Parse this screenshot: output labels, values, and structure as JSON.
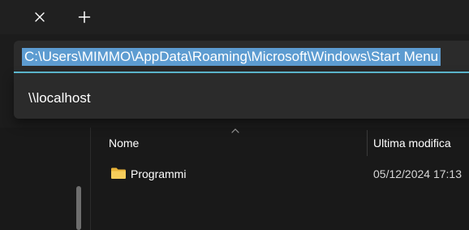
{
  "tabstrip": {
    "close_icon": "close-icon",
    "new_tab_icon": "plus-icon"
  },
  "address_bar": {
    "value": "C:\\Users\\MIMMO\\AppData\\Roaming\\Microsoft\\Windows\\Start Menu",
    "selected": true,
    "focus_color": "#61c1d9",
    "selection_color": "#5d9cd1"
  },
  "suggestions": [
    {
      "label": "\\\\localhost"
    }
  ],
  "file_list": {
    "columns": [
      {
        "label": "Nome",
        "sorted": true
      },
      {
        "label": "Ultima modifica"
      }
    ],
    "rows": [
      {
        "icon": "folder-icon",
        "name": "Programmi",
        "modified": "05/12/2024 17:13"
      }
    ]
  },
  "colors": {
    "background": "#191919",
    "surface": "#2b2b2b",
    "folder": "#f2c94c"
  }
}
